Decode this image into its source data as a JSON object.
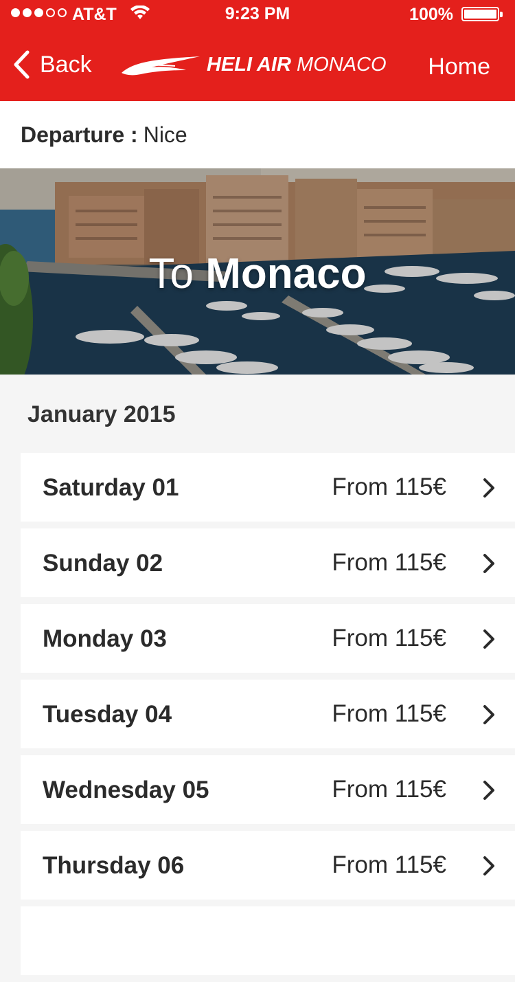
{
  "status_bar": {
    "carrier": "AT&T",
    "time": "9:23 PM",
    "battery": "100%"
  },
  "nav": {
    "back_label": "Back",
    "logo_bold": "HELI AIR",
    "logo_light": "MONACO",
    "home_label": "Home"
  },
  "departure": {
    "label": "Departure :",
    "value": "Nice"
  },
  "hero": {
    "prefix": "To",
    "destination": "Monaco"
  },
  "month": "January 2015",
  "days": [
    {
      "day": "Saturday 01",
      "price": "From 115€"
    },
    {
      "day": "Sunday 02",
      "price": "From 115€"
    },
    {
      "day": "Monday 03",
      "price": "From 115€"
    },
    {
      "day": "Tuesday 04",
      "price": "From 115€"
    },
    {
      "day": "Wednesday 05",
      "price": "From 115€"
    },
    {
      "day": "Thursday 06",
      "price": "From 115€"
    }
  ],
  "colors": {
    "brand_red": "#e4201c",
    "background": "#f5f5f5",
    "text": "#2b2b2b"
  }
}
